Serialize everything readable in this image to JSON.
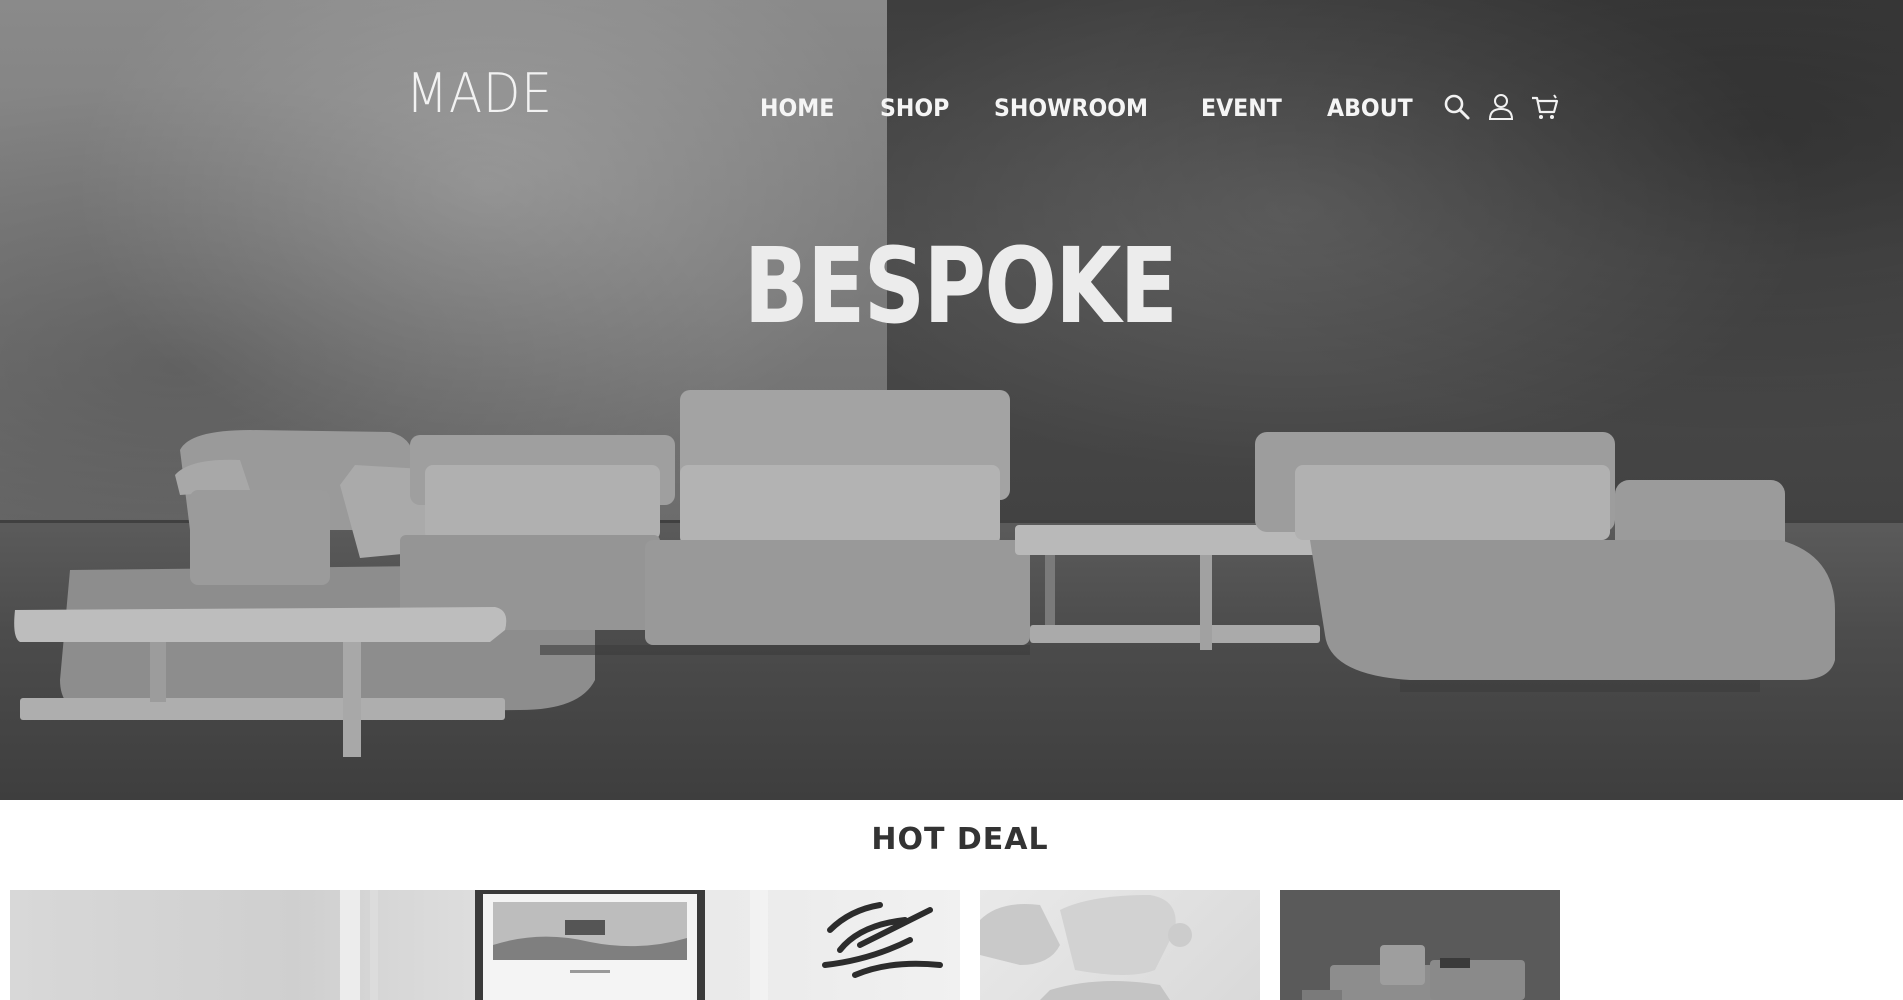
{
  "header": {
    "logo": "MADE",
    "nav": [
      {
        "label": "HOME"
      },
      {
        "label": "SHOP"
      },
      {
        "label": "SHOWROOM"
      },
      {
        "label": "EVENT"
      },
      {
        "label": "ABOUT"
      }
    ],
    "icons": [
      "search-icon",
      "user-icon",
      "cart-icon"
    ]
  },
  "hero": {
    "headline": "BESPOKE"
  },
  "hot_deal": {
    "title": "HOT DEAL",
    "tiles": [
      {
        "name": "deal-tile-living-room"
      },
      {
        "name": "deal-tile-modular-sofa"
      },
      {
        "name": "deal-tile-sectional-sofa"
      }
    ]
  },
  "colors": {
    "nav_text": "#f5f5f5",
    "headline": "#ececec",
    "section_title": "#333333",
    "page_background": "#ffffff"
  }
}
